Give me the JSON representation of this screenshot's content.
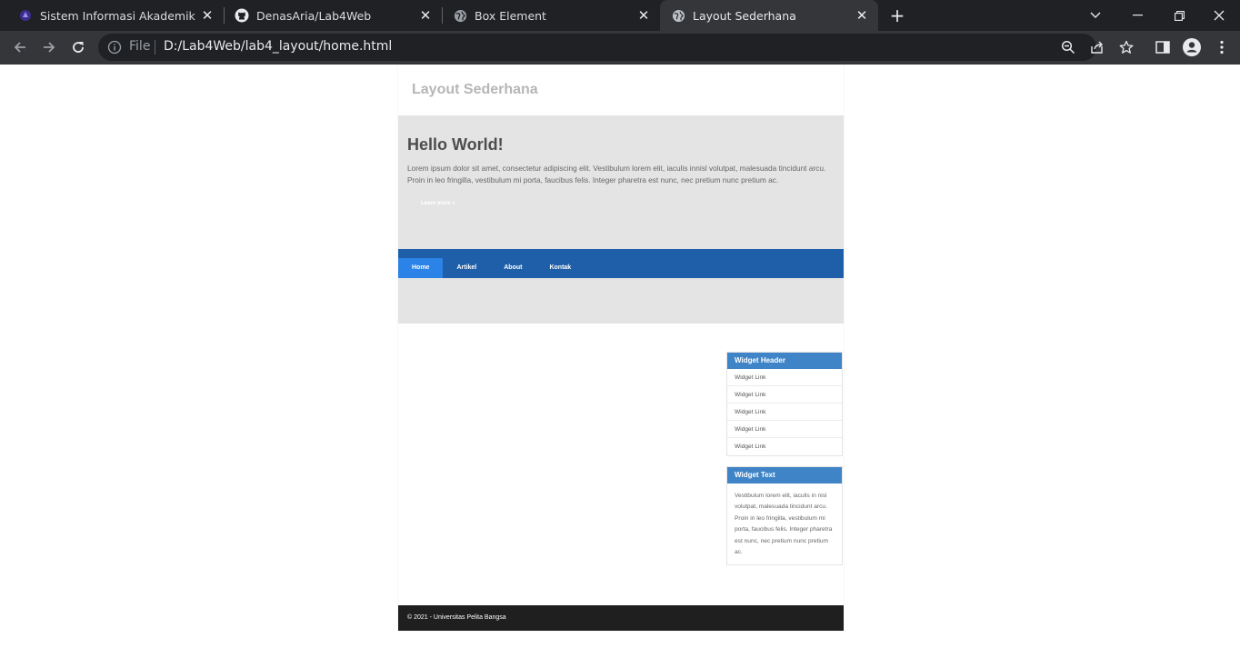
{
  "browser": {
    "tabs": [
      {
        "title": "Sistem Informasi Akademik",
        "icon": "university-logo-icon"
      },
      {
        "title": "DenasAria/Lab4Web",
        "icon": "github-icon"
      },
      {
        "title": "Box Element",
        "icon": "globe-icon"
      },
      {
        "title": "Layout Sederhana",
        "icon": "globe-icon",
        "active": true
      }
    ],
    "address": {
      "scheme_label": "File",
      "url": "D:/Lab4Web/lab4_layout/home.html"
    },
    "colors": {
      "tabbar": "#202124",
      "toolbar": "#35363a",
      "omnibox": "#202124"
    }
  },
  "page": {
    "header": {
      "title": "Layout Sederhana"
    },
    "hero": {
      "title": "Hello World!",
      "text": "Lorem ipsum dolor sit amet, consectetur adipiscing elit. Vestibulum lorem elit, iaculis innisl volutpat, malesuada tincidunt arcu. Proin in leo fringilla, vestibulum mi porta, faucibus felis. Integer pharetra est nunc, nec pretium nunc pretium ac.",
      "button": "Learn more »"
    },
    "nav": {
      "items": [
        {
          "label": "Home",
          "active": true
        },
        {
          "label": "Artikel"
        },
        {
          "label": "About"
        },
        {
          "label": "Kontak"
        }
      ]
    },
    "sidebar": {
      "widget1": {
        "header": "Widget Header",
        "links": [
          "Widget Link",
          "Widget Link",
          "Widget Link",
          "Widget Link",
          "Widget Link"
        ]
      },
      "widget2": {
        "header": "Widget Text",
        "text": "Vestibulum lorem elit, iaculis in nisl volutpat, malesuada tincidunt arcu. Proin in leo fringilla, vestibulum mi porta, faucibus felis. Integer pharetra est nunc, nec pretium nunc pretium ac."
      }
    },
    "footer": {
      "text": "© 2021 - Universitas Pelita Bangsa"
    },
    "colors": {
      "nav": "#1f5fa9",
      "nav_active": "#2b83e8",
      "widget_header": "#3f84c6",
      "band": "#e4e4e5",
      "footer": "#1f1f1f"
    }
  }
}
